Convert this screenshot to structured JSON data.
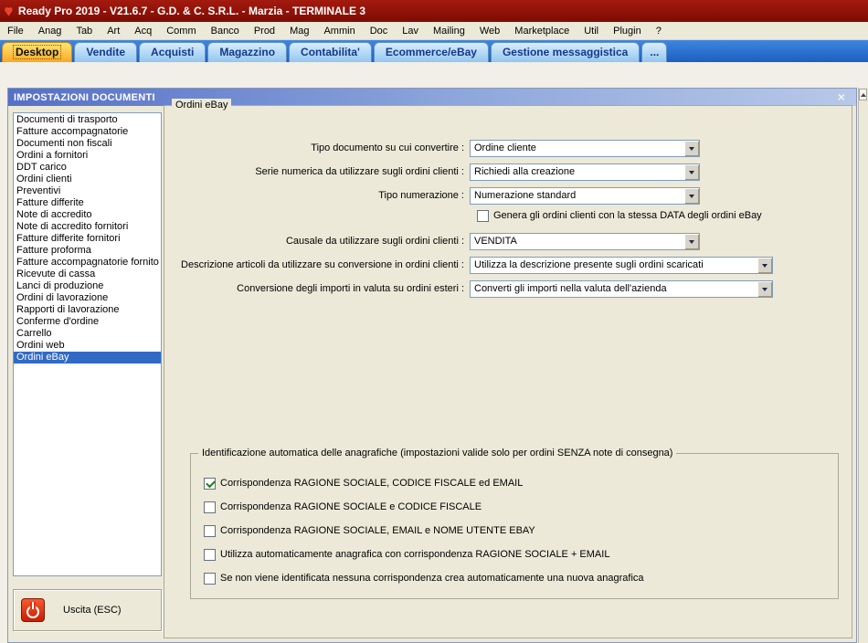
{
  "window": {
    "title": "Ready Pro 2019 - V21.6.7 - G.D. & C. S.R.L. - Marzia - TERMINALE 3"
  },
  "menu": {
    "items": [
      "File",
      "Anag",
      "Tab",
      "Art",
      "Acq",
      "Comm",
      "Banco",
      "Prod",
      "Mag",
      "Ammin",
      "Doc",
      "Lav",
      "Mailing",
      "Web",
      "Marketplace",
      "Util",
      "Plugin",
      "?"
    ]
  },
  "tabs": [
    "Desktop",
    "Vendite",
    "Acquisti",
    "Magazzino",
    "Contabilita'",
    "Ecommerce/eBay",
    "Gestione messaggistica",
    "..."
  ],
  "dialog": {
    "title": "IMPOSTAZIONI DOCUMENTI",
    "close_glyph": "×",
    "sidebar_items": [
      "Documenti di trasporto",
      "Fatture accompagnatorie",
      "Documenti non fiscali",
      "Ordini a fornitori",
      "DDT carico",
      "Ordini clienti",
      "Preventivi",
      "Fatture differite",
      "Note di accredito",
      "Note di accredito fornitori",
      "Fatture differite fornitori",
      "Fatture proforma",
      "Fatture accompagnatorie fornito",
      "Ricevute di cassa",
      "Lanci di produzione",
      "Ordini di lavorazione",
      "Rapporti di lavorazione",
      "Conferme d'ordine",
      "Carrello",
      "Ordini web",
      "Ordini eBay"
    ],
    "selected_item": "Ordini eBay",
    "exit_label": "Uscita (ESC)",
    "panel": {
      "legend": "Ordini eBay",
      "fields": [
        {
          "label": "Tipo documento su cui convertire :",
          "value": "Ordine cliente"
        },
        {
          "label": "Serie numerica da utilizzare sugli ordini clienti :",
          "value": "Richiedi alla creazione"
        },
        {
          "label": "Tipo numerazione :",
          "value": "Numerazione standard"
        },
        {
          "label": "Causale da utilizzare sugli ordini clienti :",
          "value": "VENDITA"
        },
        {
          "label": "Descrizione articoli da utilizzare su conversione in ordini clienti :",
          "value": "Utilizza la descrizione presente sugli ordini scaricati"
        },
        {
          "label": "Conversione degli importi in valuta su ordini esteri :",
          "value": "Converti gli importi nella valuta dell'azienda"
        }
      ],
      "date_checkbox": {
        "label": "Genera gli ordini clienti con la stessa DATA degli ordini eBay",
        "checked": false
      },
      "anagrafiche": {
        "legend": "Identificazione automatica delle anagrafiche (impostazioni valide solo per ordini SENZA note di consegna)",
        "options": [
          {
            "label": "Corrispondenza RAGIONE SOCIALE, CODICE FISCALE ed EMAIL",
            "checked": true
          },
          {
            "label": "Corrispondenza RAGIONE SOCIALE e CODICE FISCALE",
            "checked": false
          },
          {
            "label": "Corrispondenza RAGIONE SOCIALE, EMAIL e NOME UTENTE EBAY",
            "checked": false
          },
          {
            "label": "Utilizza automaticamente anagrafica con corrispondenza RAGIONE SOCIALE + EMAIL",
            "checked": false
          },
          {
            "label": "Se non viene identificata nessuna corrispondenza crea automaticamente una nuova anagrafica",
            "checked": false
          }
        ]
      }
    }
  },
  "icons": {
    "app_logo": "heart-icon",
    "dropdown": "chevron-down-icon",
    "power": "power-icon"
  },
  "colors": {
    "titlebar_red": "#8E1006",
    "dialog_title_blue": "#5670C8",
    "tab_active_orange": "#F9A825",
    "selection_blue": "#316AC5",
    "check_green": "#1C7C1C"
  }
}
